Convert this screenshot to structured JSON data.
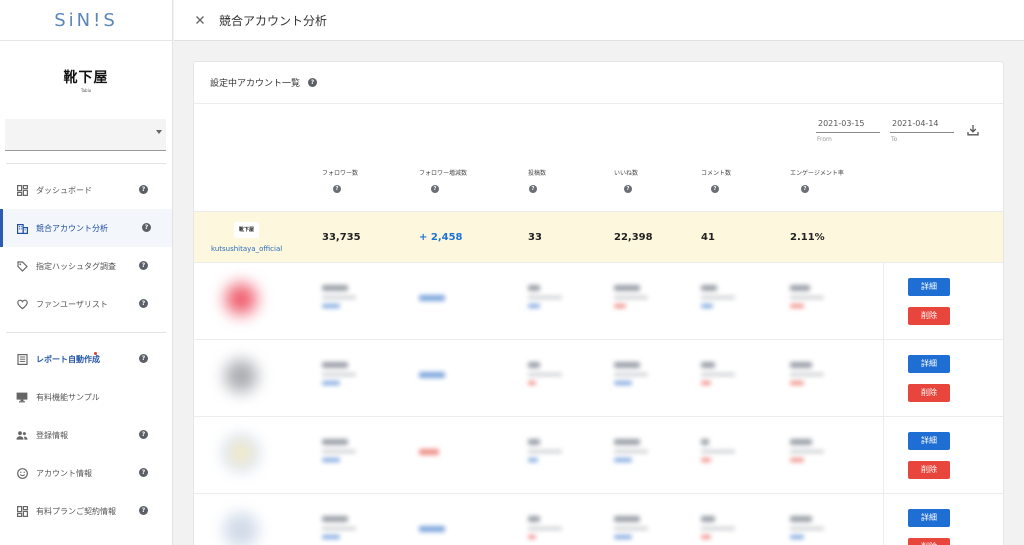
{
  "app": {
    "logo": "SiN!S"
  },
  "brand": {
    "name": "靴下屋",
    "sub": "Tabio"
  },
  "sidebar": {
    "items": [
      {
        "label": "ダッシュボード",
        "icon": "dashboard-icon",
        "help": "?"
      },
      {
        "label": "競合アカウント分析",
        "icon": "building-icon",
        "help": "?",
        "active": true
      },
      {
        "label": "指定ハッシュタグ調査",
        "icon": "tag-icon",
        "help": "?"
      },
      {
        "label": "ファンユーザリスト",
        "icon": "heart-icon",
        "help": "?"
      },
      {
        "label": "レポート自動作成",
        "icon": "report-icon",
        "help": "?",
        "badge": "new-dot"
      },
      {
        "label": "有料機能サンプル",
        "icon": "monitor-icon"
      },
      {
        "label": "登録情報",
        "icon": "people-icon",
        "help": "?"
      },
      {
        "label": "アカウント情報",
        "icon": "smile-icon",
        "help": "?"
      },
      {
        "label": "有料プランご契約情報",
        "icon": "dashboard-icon",
        "help": "?"
      }
    ]
  },
  "topbar": {
    "close_icon": "close-icon",
    "title": "競合アカウント分析"
  },
  "card": {
    "title": "設定中アカウント一覧",
    "help": "?",
    "date_from": {
      "value": "2021-03-15",
      "label": "From"
    },
    "date_to": {
      "value": "2021-04-14",
      "label": "To"
    },
    "columns": [
      "フォロワー数",
      "フォロワー増減数",
      "投稿数",
      "いいね数",
      "コメント数",
      "エンゲージメント率"
    ],
    "own_account": {
      "handle": "kutsushitaya_official",
      "logo_text": "靴下屋",
      "followers": "33,735",
      "follower_change": "+ 2,458",
      "posts": "33",
      "likes": "22,398",
      "comments": "41",
      "engagement": "2.11%"
    },
    "competitor_actions": {
      "detail": "詳細",
      "delete": "削除"
    }
  },
  "colors": {
    "accent": "#1f6ed4",
    "danger": "#e8453c",
    "own_row": "#fdf8dd",
    "link": "#2c6ab8"
  }
}
